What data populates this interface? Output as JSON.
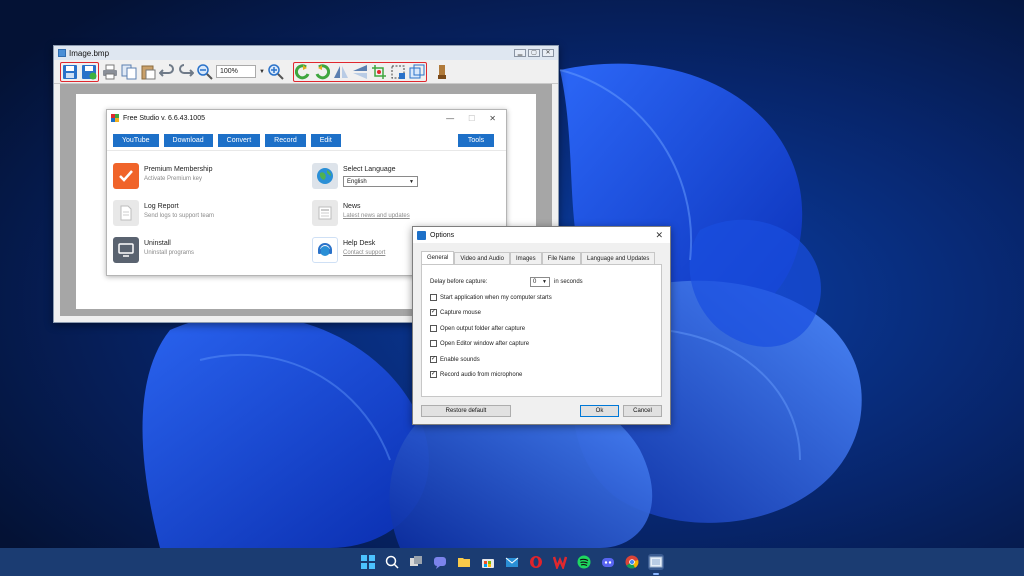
{
  "editor": {
    "title": "Image.bmp",
    "zoom_value": "100%",
    "toolbar_icons": [
      "save-icon",
      "save-as-icon",
      "print-icon",
      "copy-icon",
      "paste-icon",
      "undo-icon",
      "redo-icon",
      "zoom-out-icon",
      "zoom-in-icon",
      "rotate-left-icon",
      "rotate-right-icon",
      "flip-horizontal-icon",
      "flip-vertical-icon",
      "crop-icon",
      "select-icon",
      "resize-icon",
      "brush-icon"
    ]
  },
  "free_studio": {
    "title": "Free Studio v. 6.6.43.1005",
    "menu": [
      "YouTube",
      "Download",
      "Convert",
      "Record",
      "Edit"
    ],
    "tools_label": "Tools",
    "items": {
      "premium": {
        "label": "Premium Membership",
        "sub": "Activate Premium key"
      },
      "language": {
        "label": "Select Language",
        "value": "English"
      },
      "log": {
        "label": "Log Report",
        "sub": "Send logs to support team"
      },
      "news": {
        "label": "News",
        "sub": "Latest news and updates"
      },
      "uninstall": {
        "label": "Uninstall",
        "sub": "Uninstall programs"
      },
      "help": {
        "label": "Help Desk",
        "sub": "Contact support"
      }
    }
  },
  "options": {
    "title": "Options",
    "close": "✕",
    "tabs": [
      "General",
      "Video and Audio",
      "Images",
      "File Name",
      "Language and Updates"
    ],
    "active_tab": "General",
    "delay_label": "Delay before capture:",
    "delay_value": "0",
    "delay_unit": "in seconds",
    "checkboxes": [
      {
        "label": "Start application when my computer starts",
        "checked": false
      },
      {
        "label": "Capture mouse",
        "checked": true
      },
      {
        "label": "Open output folder after capture",
        "checked": false
      },
      {
        "label": "Open Editor window after capture",
        "checked": false
      },
      {
        "label": "Enable sounds",
        "checked": true
      },
      {
        "label": "Record audio from microphone",
        "checked": true
      }
    ],
    "restore_label": "Restore default",
    "ok_label": "Ok",
    "cancel_label": "Cancel"
  },
  "taskbar": {
    "icons": [
      "windows-start-icon",
      "search-icon",
      "task-view-icon",
      "teams-chat-icon",
      "file-explorer-icon",
      "store-icon",
      "mail-icon",
      "opera-icon",
      "wps-office-icon",
      "spotify-icon",
      "discord-icon",
      "chrome-icon",
      "screenshot-app-icon"
    ]
  },
  "colors": {
    "accent": "#1d70c8",
    "highlight": "#e0282e",
    "desktop": "#06153a"
  }
}
